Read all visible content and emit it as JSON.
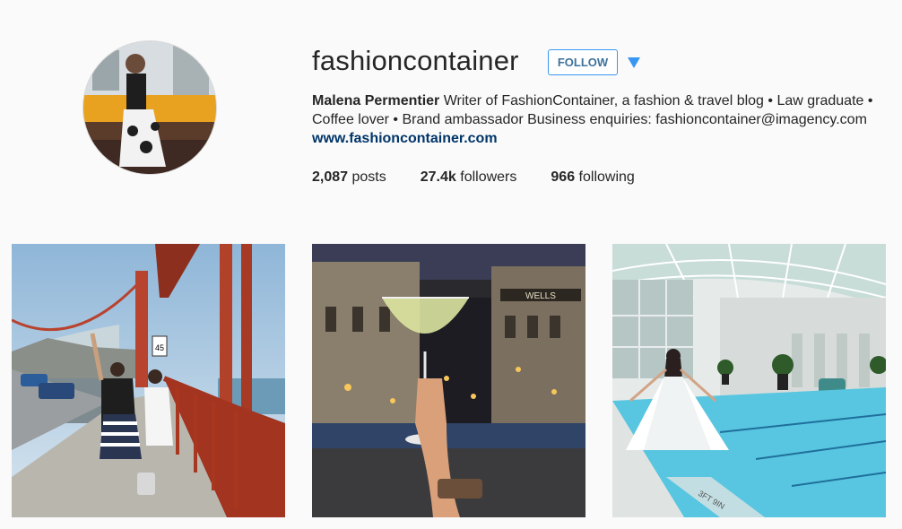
{
  "profile": {
    "username": "fashioncontainer",
    "follow_label": "FOLLOW",
    "more_icon": "triangle-down-icon",
    "accent_color": "#3897f0",
    "bio": {
      "full_name": "Malena Permentier",
      "text": " Writer of FashionContainer, a fashion & travel blog • Law graduate • Coffee lover • Brand ambassador Business enquiries: fashioncontainer@imagency.com ",
      "website": "www.fashioncontainer.com"
    },
    "stats": {
      "posts_count": "2,087",
      "posts_label": "posts",
      "followers_count": "27.4k",
      "followers_label": "followers",
      "following_count": "966",
      "following_label": "following"
    }
  },
  "posts": [
    {
      "subject": "Golden Gate Bridge",
      "sign_text": "45"
    },
    {
      "subject": "Cocktail over city night",
      "sign_text": "WELLS"
    },
    {
      "subject": "Indoor pool",
      "sign_text": "3FT 9IN"
    }
  ]
}
